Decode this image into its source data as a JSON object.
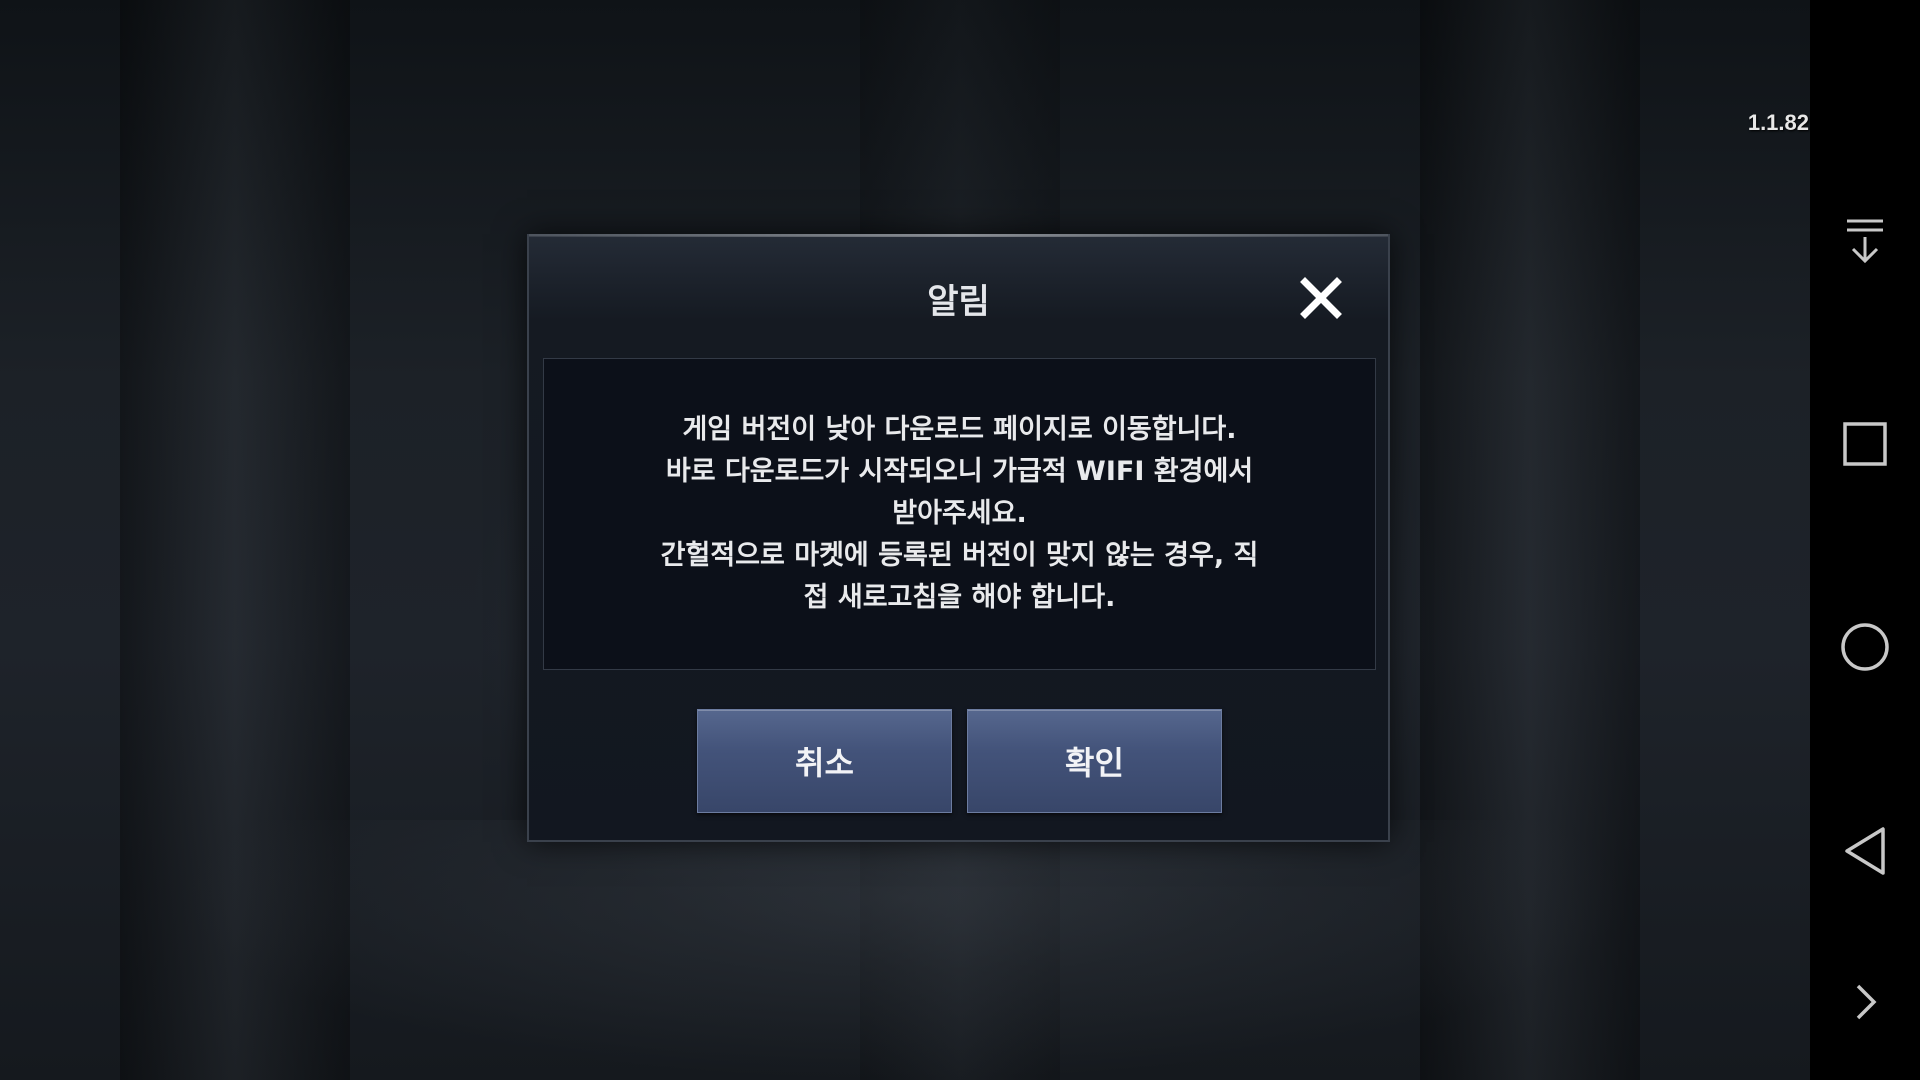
{
  "version": "1.1.82",
  "dialog": {
    "title": "알림",
    "message": "게임 버전이 낮아 다운로드 페이지로 이동합니다.\n바로 다운로드가 시작되오니 가급적 WIFI 환경에서\n받아주세요.\n간헐적으로 마켓에 등록된 버전이 맞지 않는 경우, 직\n접 새로고침을 해야 합니다.",
    "cancel_label": "취소",
    "confirm_label": "확인"
  },
  "navbar": {
    "icons": [
      "notification-drawer-icon",
      "recent-apps-icon",
      "home-icon",
      "back-icon",
      "expand-icon"
    ]
  },
  "colors": {
    "button": "#46567c",
    "dialog_bg": "#151a22",
    "navbar_bg": "#000000"
  }
}
